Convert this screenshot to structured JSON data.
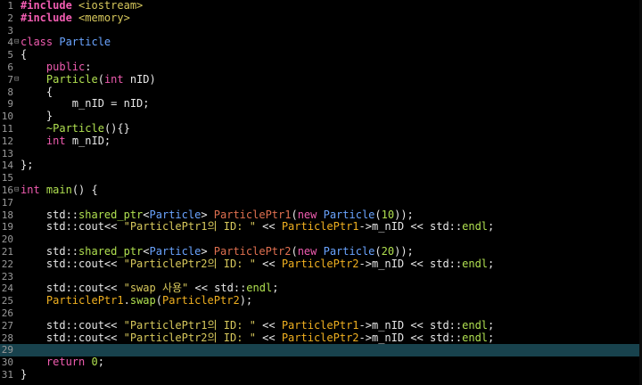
{
  "editor": {
    "lines": [
      {
        "n": "1",
        "fold": "",
        "tokens": [
          [
            "t-pre",
            "#include "
          ],
          [
            "t-inc",
            "<iostream>"
          ]
        ]
      },
      {
        "n": "2",
        "fold": "",
        "tokens": [
          [
            "t-pre",
            "#include "
          ],
          [
            "t-inc",
            "<memory>"
          ]
        ]
      },
      {
        "n": "3",
        "fold": "",
        "tokens": []
      },
      {
        "n": "4",
        "fold": "⊟",
        "tokens": [
          [
            "t-kw",
            "class "
          ],
          [
            "t-cls",
            "Particle"
          ]
        ]
      },
      {
        "n": "5",
        "fold": "",
        "tokens": [
          [
            "t-punc",
            "{"
          ]
        ]
      },
      {
        "n": "6",
        "fold": "",
        "tokens": [
          [
            "t-punc",
            "    "
          ],
          [
            "t-kw",
            "public"
          ],
          [
            "t-punc",
            ":"
          ]
        ]
      },
      {
        "n": "7",
        "fold": "⊟",
        "tokens": [
          [
            "t-punc",
            "    "
          ],
          [
            "t-fn",
            "Particle"
          ],
          [
            "t-punc",
            "("
          ],
          [
            "t-kw",
            "int "
          ],
          [
            "t-id",
            "nID"
          ],
          [
            "t-punc",
            ")"
          ]
        ]
      },
      {
        "n": "8",
        "fold": "",
        "tokens": [
          [
            "t-punc",
            "    {"
          ]
        ]
      },
      {
        "n": "9",
        "fold": "",
        "tokens": [
          [
            "t-punc",
            "        "
          ],
          [
            "t-id",
            "m_nID = nID;"
          ]
        ]
      },
      {
        "n": "10",
        "fold": "",
        "tokens": [
          [
            "t-punc",
            "    }"
          ]
        ]
      },
      {
        "n": "11",
        "fold": "",
        "tokens": [
          [
            "t-punc",
            "    "
          ],
          [
            "t-fn",
            "~Particle"
          ],
          [
            "t-punc",
            "(){}"
          ]
        ]
      },
      {
        "n": "12",
        "fold": "",
        "tokens": [
          [
            "t-punc",
            "    "
          ],
          [
            "t-kw",
            "int "
          ],
          [
            "t-id",
            "m_nID;"
          ]
        ]
      },
      {
        "n": "13",
        "fold": "",
        "tokens": []
      },
      {
        "n": "14",
        "fold": "",
        "tokens": [
          [
            "t-punc",
            "};"
          ]
        ]
      },
      {
        "n": "15",
        "fold": "",
        "tokens": []
      },
      {
        "n": "16",
        "fold": "⊟",
        "tokens": [
          [
            "t-kw",
            "int "
          ],
          [
            "t-fn",
            "main"
          ],
          [
            "t-punc",
            "() {"
          ]
        ]
      },
      {
        "n": "17",
        "fold": "",
        "tokens": []
      },
      {
        "n": "18",
        "fold": "",
        "tokens": [
          [
            "t-punc",
            "    "
          ],
          [
            "t-ns",
            "std::"
          ],
          [
            "t-std",
            "shared_ptr"
          ],
          [
            "t-punc",
            "<"
          ],
          [
            "t-cls",
            "Particle"
          ],
          [
            "t-punc",
            "> "
          ],
          [
            "t-ptr",
            "ParticlePtr1"
          ],
          [
            "t-punc",
            "("
          ],
          [
            "t-kw",
            "new "
          ],
          [
            "t-cls",
            "Particle"
          ],
          [
            "t-punc",
            "("
          ],
          [
            "t-num",
            "10"
          ],
          [
            "t-punc",
            "));"
          ]
        ]
      },
      {
        "n": "19",
        "fold": "",
        "tokens": [
          [
            "t-punc",
            "    "
          ],
          [
            "t-ns",
            "std::cout<< "
          ],
          [
            "t-str",
            "\"ParticlePtr1의 ID: \""
          ],
          [
            "t-punc",
            " << "
          ],
          [
            "t-obj",
            "ParticlePtr1"
          ],
          [
            "t-punc",
            "->m_nID << std::"
          ],
          [
            "t-std",
            "endl"
          ],
          [
            "t-punc",
            ";"
          ]
        ]
      },
      {
        "n": "20",
        "fold": "",
        "tokens": []
      },
      {
        "n": "21",
        "fold": "",
        "tokens": [
          [
            "t-punc",
            "    "
          ],
          [
            "t-ns",
            "std::"
          ],
          [
            "t-std",
            "shared_ptr"
          ],
          [
            "t-punc",
            "<"
          ],
          [
            "t-cls",
            "Particle"
          ],
          [
            "t-punc",
            "> "
          ],
          [
            "t-ptr",
            "ParticlePtr2"
          ],
          [
            "t-punc",
            "("
          ],
          [
            "t-kw",
            "new "
          ],
          [
            "t-cls",
            "Particle"
          ],
          [
            "t-punc",
            "("
          ],
          [
            "t-num",
            "20"
          ],
          [
            "t-punc",
            "));"
          ]
        ]
      },
      {
        "n": "22",
        "fold": "",
        "tokens": [
          [
            "t-punc",
            "    "
          ],
          [
            "t-ns",
            "std::cout<< "
          ],
          [
            "t-str",
            "\"ParticlePtr2의 ID: \""
          ],
          [
            "t-punc",
            " << "
          ],
          [
            "t-obj",
            "ParticlePtr2"
          ],
          [
            "t-punc",
            "->m_nID << std::"
          ],
          [
            "t-std",
            "endl"
          ],
          [
            "t-punc",
            ";"
          ]
        ]
      },
      {
        "n": "23",
        "fold": "",
        "tokens": []
      },
      {
        "n": "24",
        "fold": "",
        "tokens": [
          [
            "t-punc",
            "    "
          ],
          [
            "t-ns",
            "std::cout<< "
          ],
          [
            "t-str",
            "\"swap 사용\""
          ],
          [
            "t-punc",
            " << std::"
          ],
          [
            "t-std",
            "endl"
          ],
          [
            "t-punc",
            ";"
          ]
        ]
      },
      {
        "n": "25",
        "fold": "",
        "tokens": [
          [
            "t-punc",
            "    "
          ],
          [
            "t-obj",
            "ParticlePtr1"
          ],
          [
            "t-punc",
            "."
          ],
          [
            "t-fn",
            "swap"
          ],
          [
            "t-punc",
            "("
          ],
          [
            "t-obj",
            "ParticlePtr2"
          ],
          [
            "t-punc",
            ");"
          ]
        ]
      },
      {
        "n": "26",
        "fold": "",
        "tokens": []
      },
      {
        "n": "27",
        "fold": "",
        "tokens": [
          [
            "t-punc",
            "    "
          ],
          [
            "t-ns",
            "std::cout<< "
          ],
          [
            "t-str",
            "\"ParticlePtr1의 ID: \""
          ],
          [
            "t-punc",
            " << "
          ],
          [
            "t-obj",
            "ParticlePtr1"
          ],
          [
            "t-punc",
            "->m_nID << std::"
          ],
          [
            "t-std",
            "endl"
          ],
          [
            "t-punc",
            ";"
          ]
        ]
      },
      {
        "n": "28",
        "fold": "",
        "tokens": [
          [
            "t-punc",
            "    "
          ],
          [
            "t-ns",
            "std::cout<< "
          ],
          [
            "t-str",
            "\"ParticlePtr2의 ID: \""
          ],
          [
            "t-punc",
            " << "
          ],
          [
            "t-obj",
            "ParticlePtr2"
          ],
          [
            "t-punc",
            "->m_nID << std::"
          ],
          [
            "t-std",
            "endl"
          ],
          [
            "t-punc",
            ";"
          ]
        ]
      },
      {
        "n": "29",
        "fold": "",
        "tokens": [],
        "current": true
      },
      {
        "n": "30",
        "fold": "",
        "tokens": [
          [
            "t-punc",
            "    "
          ],
          [
            "t-kw",
            "return "
          ],
          [
            "t-num",
            "0"
          ],
          [
            "t-punc",
            ";"
          ]
        ]
      },
      {
        "n": "31",
        "fold": "",
        "tokens": [
          [
            "t-punc",
            "}"
          ]
        ]
      }
    ]
  },
  "colors": {
    "background": "#000000",
    "current_line": "#18424d",
    "keyword": "#f05cb0",
    "class_name": "#6aa4ff",
    "function": "#b0e050",
    "string": "#d7c85c",
    "variable": "#f0b020"
  }
}
